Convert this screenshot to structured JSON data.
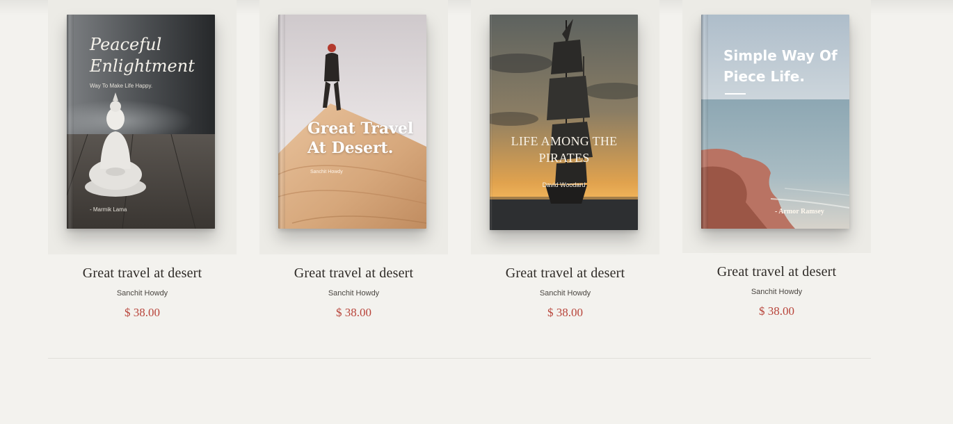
{
  "products": [
    {
      "cover_title_line1": "Peaceful",
      "cover_title_line2": "Enlightment",
      "cover_subtitle": "Way To Make Life Happy.",
      "cover_author": "- Marmik Lama",
      "title": "Great travel at desert",
      "author": "Sanchit Howdy",
      "price": "$ 38.00"
    },
    {
      "cover_title_line1": "Great Travel",
      "cover_title_line2": "At Desert.",
      "cover_author": "Sanchit Howdy",
      "title": "Great travel at desert",
      "author": "Sanchit Howdy",
      "price": "$ 38.00"
    },
    {
      "cover_title_line1": "LIFE AMONG THE",
      "cover_title_line2": "PIRATES",
      "cover_author": "David Woodard",
      "title": "Great travel at desert",
      "author": "Sanchit Howdy",
      "price": "$ 38.00"
    },
    {
      "cover_title_line1": "Simple Way Of",
      "cover_title_line2": "Piece Life.",
      "cover_author": "- Armor Ramsey",
      "title": "Great travel at desert",
      "author": "Sanchit Howdy",
      "price": "$ 38.00"
    }
  ],
  "colors": {
    "background": "#f3f2ee",
    "card": "#ecebe6",
    "title_text": "#2e2a26",
    "price": "#b8443a"
  }
}
